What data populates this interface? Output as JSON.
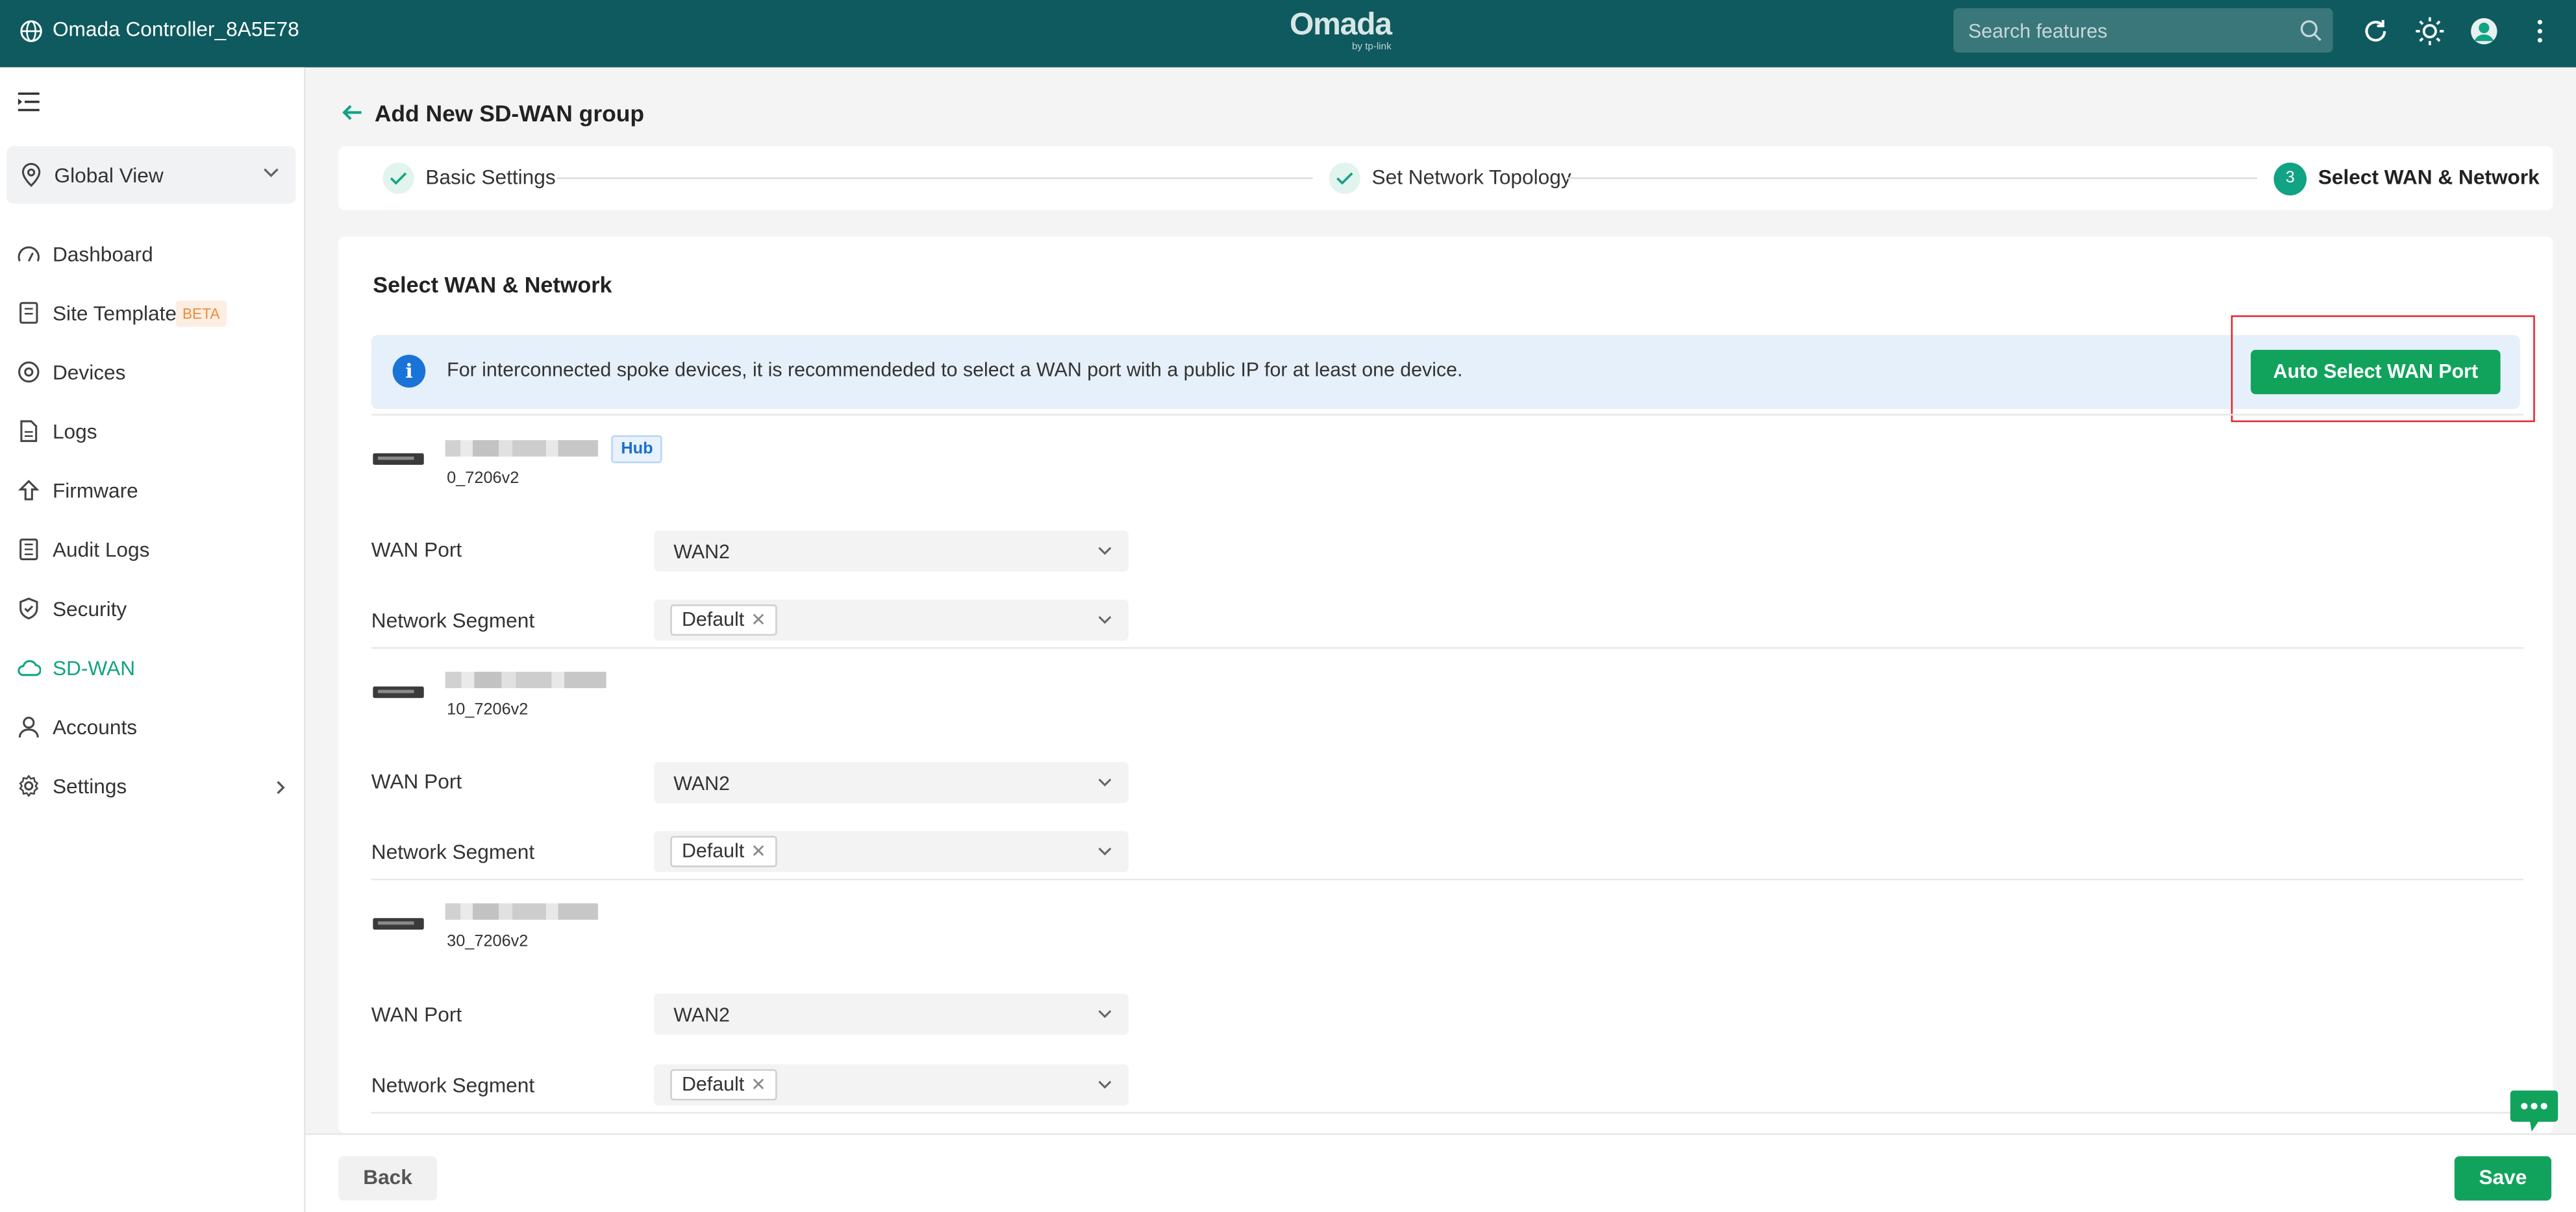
{
  "header": {
    "controller_name": "Omada Controller_8A5E78",
    "logo_text": "Omada",
    "logo_sub": "by tp-link",
    "search_placeholder": "Search features",
    "icons": [
      "globe-icon",
      "search-icon",
      "refresh-icon",
      "theme-sun-icon",
      "user-avatar-icon",
      "more-vertical-icon"
    ]
  },
  "sidebar": {
    "scope": "Global View",
    "items": [
      {
        "label": "Dashboard",
        "icon": "dashboard-icon"
      },
      {
        "label": "Site Template",
        "icon": "template-icon",
        "badge": "BETA"
      },
      {
        "label": "Devices",
        "icon": "devices-icon"
      },
      {
        "label": "Logs",
        "icon": "logs-icon"
      },
      {
        "label": "Firmware",
        "icon": "firmware-icon"
      },
      {
        "label": "Audit Logs",
        "icon": "audit-logs-icon"
      },
      {
        "label": "Security",
        "icon": "shield-icon"
      },
      {
        "label": "SD-WAN",
        "icon": "cloud-icon",
        "active": true
      },
      {
        "label": "Accounts",
        "icon": "user-icon"
      },
      {
        "label": "Settings",
        "icon": "gear-icon"
      }
    ]
  },
  "page": {
    "title": "Add New SD-WAN group",
    "steps": [
      {
        "label": "Basic Settings",
        "status": "done"
      },
      {
        "label": "Set Network Topology",
        "status": "done"
      },
      {
        "label": "Select WAN & Network",
        "status": "current",
        "number": "3"
      }
    ]
  },
  "section": {
    "title": "Select WAN & Network",
    "info_text": "For interconnected spoke devices, it is recommendeded to select a WAN port with a public IP for at least one device.",
    "auto_select_label": "Auto Select WAN Port"
  },
  "devices": [
    {
      "model": "0_7206v2",
      "badge": "Hub",
      "wan_port": "WAN2",
      "segment": "Default"
    },
    {
      "model": "10_7206v2",
      "badge": "",
      "wan_port": "WAN2",
      "segment": "Default"
    },
    {
      "model": "30_7206v2",
      "badge": "",
      "wan_port": "WAN2",
      "segment": "Default"
    }
  ],
  "labels": {
    "wan_port": "WAN Port",
    "network_segment": "Network Segment"
  },
  "footer": {
    "back": "Back",
    "save": "Save"
  },
  "colors": {
    "header_bg": "#0e5a5e",
    "accent": "#11a383",
    "primary_button": "#11a35c",
    "highlight_box": "#e0262b",
    "info_bg": "#e6f0fa"
  }
}
